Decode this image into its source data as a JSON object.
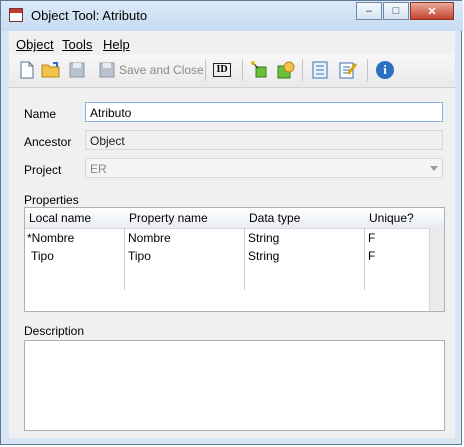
{
  "window": {
    "title": "Object Tool: Atributo",
    "min_label": "–",
    "max_label": "□",
    "close_label": "✕"
  },
  "menu": {
    "object": "Object",
    "tools": "Tools",
    "help": "Help"
  },
  "toolbar": {
    "save_and_close_label": "Save and Close",
    "id_label": "ID",
    "info_label": "i",
    "icons": [
      "new-icon",
      "open-icon",
      "save-icon",
      "save-close-icon",
      "id-icon",
      "graph-icon",
      "shapes-icon",
      "properties-icon",
      "edit-icon",
      "info-icon"
    ]
  },
  "form": {
    "name_label": "Name",
    "name_value": "Atributo",
    "ancestor_label": "Ancestor",
    "ancestor_value": "Object",
    "project_label": "Project",
    "project_value": "ER"
  },
  "properties": {
    "label": "Properties",
    "columns": [
      "Local name",
      "Property name",
      "Data type",
      "Unique?"
    ],
    "rows": [
      [
        "*Nombre",
        "Nombre",
        "String",
        "F"
      ],
      [
        "Tipo",
        "Tipo",
        "String",
        "F"
      ]
    ]
  },
  "description": {
    "label": "Description",
    "value": ""
  },
  "colors": {
    "frame": "#d8e6f4",
    "client": "#f0f0f0",
    "focus_border": "#7eb4ea"
  }
}
